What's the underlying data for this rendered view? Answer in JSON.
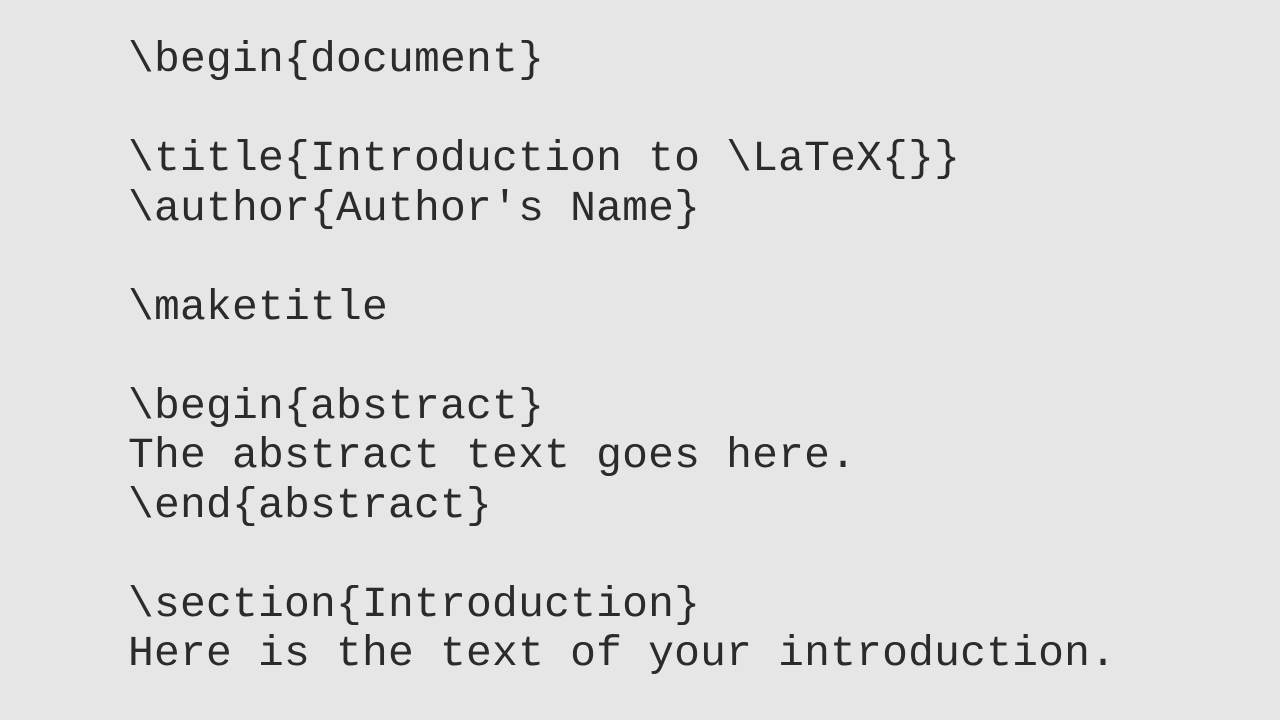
{
  "document": {
    "lines": [
      "\\begin{document}",
      "",
      "\\title{Introduction to \\LaTeX{}}",
      "\\author{Author's Name}",
      "",
      "\\maketitle",
      "",
      "\\begin{abstract}",
      "The abstract text goes here.",
      "\\end{abstract}",
      "",
      "\\section{Introduction}",
      "Here is the text of your introduction."
    ]
  }
}
